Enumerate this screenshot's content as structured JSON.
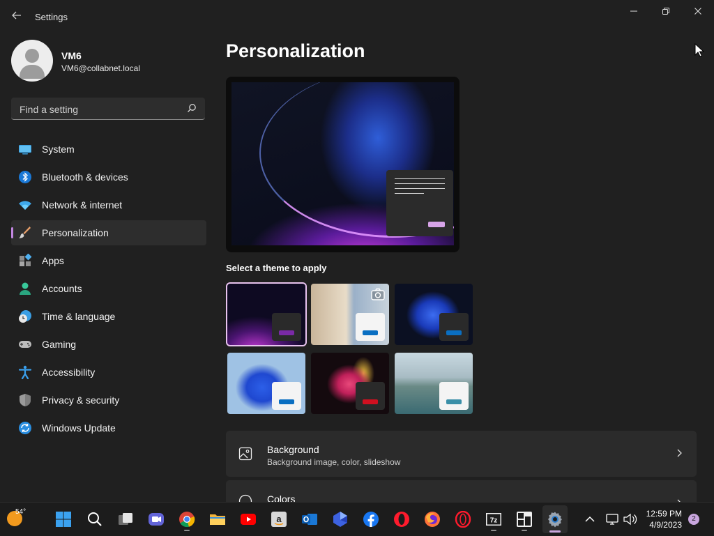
{
  "window": {
    "title": "Settings",
    "minimize_icon": "minimize-icon",
    "maximize_icon": "restore-icon",
    "close_icon": "close-icon"
  },
  "profile": {
    "name": "VM6",
    "email": "VM6@collabnet.local"
  },
  "search": {
    "placeholder": "Find a setting",
    "value": ""
  },
  "sidebar": {
    "items": [
      {
        "label": "System",
        "icon": "system-icon",
        "active": false
      },
      {
        "label": "Bluetooth & devices",
        "icon": "bluetooth-icon",
        "active": false
      },
      {
        "label": "Network & internet",
        "icon": "wifi-icon",
        "active": false
      },
      {
        "label": "Personalization",
        "icon": "brush-icon",
        "active": true
      },
      {
        "label": "Apps",
        "icon": "apps-icon",
        "active": false
      },
      {
        "label": "Accounts",
        "icon": "accounts-icon",
        "active": false
      },
      {
        "label": "Time & language",
        "icon": "clock-globe-icon",
        "active": false
      },
      {
        "label": "Gaming",
        "icon": "gamepad-icon",
        "active": false
      },
      {
        "label": "Accessibility",
        "icon": "accessibility-icon",
        "active": false
      },
      {
        "label": "Privacy & security",
        "icon": "shield-icon",
        "active": false
      },
      {
        "label": "Windows Update",
        "icon": "update-icon",
        "active": false
      }
    ]
  },
  "main": {
    "title": "Personalization",
    "themes_label": "Select a theme to apply",
    "themes": [
      {
        "name": "theme-windows-dark-glow",
        "selected": true,
        "accent": "#7a2aa6"
      },
      {
        "name": "theme-spotlight",
        "selected": false,
        "accent": "#0a6fc2"
      },
      {
        "name": "theme-windows-bloom-dark",
        "selected": false,
        "accent": "#0a6fc2"
      },
      {
        "name": "theme-windows-bloom-light",
        "selected": false,
        "accent": "#0a6fc2"
      },
      {
        "name": "theme-captured-motion",
        "selected": false,
        "accent": "#d01020"
      },
      {
        "name": "theme-flow",
        "selected": false,
        "accent": "#3a8fa8"
      }
    ],
    "cards": [
      {
        "title": "Background",
        "subtitle": "Background image, color, slideshow",
        "icon": "image-icon"
      },
      {
        "title": "Colors",
        "subtitle": "",
        "icon": "palette-icon"
      }
    ]
  },
  "taskbar": {
    "weather_temp": "54°",
    "time": "12:59 PM",
    "date": "4/9/2023",
    "notification_count": "2",
    "accent": "#c9a6de"
  }
}
